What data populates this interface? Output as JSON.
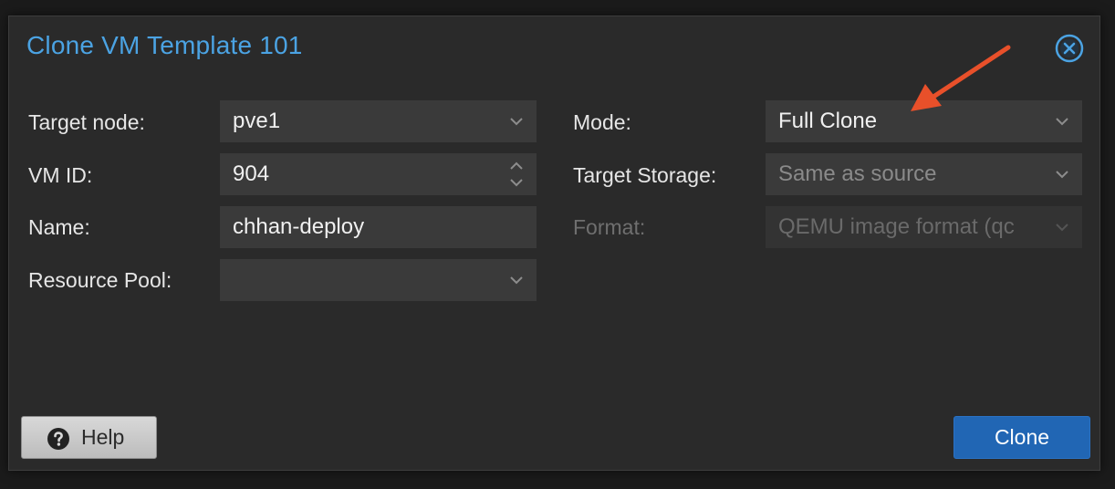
{
  "dialog": {
    "title": "Clone VM Template 101",
    "close_icon": "close-circle-icon"
  },
  "left": {
    "target_node": {
      "label": "Target node:",
      "value": "pve1"
    },
    "vm_id": {
      "label": "VM ID:",
      "value": "904"
    },
    "name": {
      "label": "Name:",
      "value": "chhan-deploy"
    },
    "resource_pool": {
      "label": "Resource Pool:",
      "value": ""
    }
  },
  "right": {
    "mode": {
      "label": "Mode:",
      "value": "Full Clone"
    },
    "target_storage": {
      "label": "Target Storage:",
      "placeholder": "Same as source"
    },
    "format": {
      "label": "Format:",
      "placeholder": "QEMU image format (qc"
    }
  },
  "buttons": {
    "help": "Help",
    "clone": "Clone"
  },
  "annotation": {
    "arrow_color": "#e8502a",
    "arrow_icon": "red-arrow-annotation"
  },
  "colors": {
    "title": "#4ba3e3",
    "clone_button": "#2166b4"
  }
}
